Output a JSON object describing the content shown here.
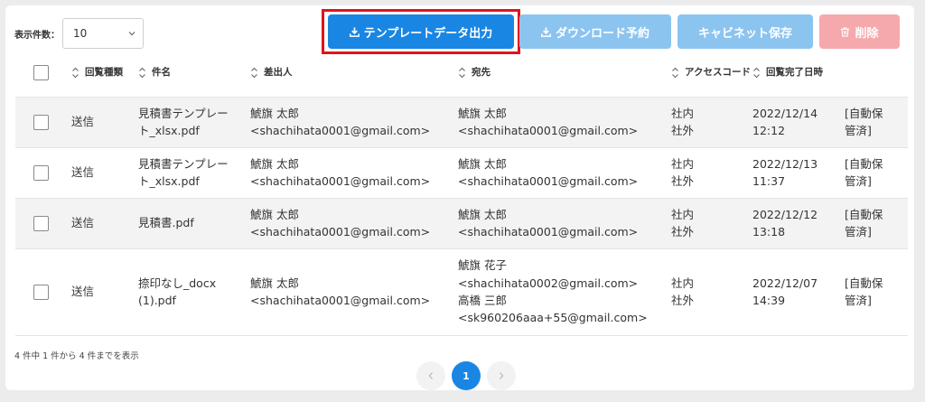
{
  "toolbar": {
    "per_page_label": "表示件数：",
    "per_page_value": "10",
    "template_output_label": "テンプレートデータ出力",
    "download_reserve_label": "ダウンロード予約",
    "cabinet_save_label": "キャビネット保存",
    "delete_label": "削除"
  },
  "table": {
    "headers": {
      "type": [
        "回覧",
        "種類"
      ],
      "subject": "件名",
      "sender": "差出人",
      "recipient": "宛先",
      "access_code": [
        "アクセス",
        "コード"
      ],
      "completed_at": [
        "回覧完了日",
        "時"
      ]
    },
    "rows": [
      {
        "type": "送信",
        "subject": [
          "見積書テンプレー",
          "ト_xlsx.pdf"
        ],
        "sender": [
          "鯱旗 太郎",
          "<shachihata0001@gmail.com>"
        ],
        "recipient": [
          "鯱旗 太郎",
          "<shachihata0001@gmail.com>"
        ],
        "access": [
          "社内",
          "社外"
        ],
        "date": [
          "2022/12/14",
          "12:12"
        ],
        "status": [
          "[自動保",
          "管済]"
        ]
      },
      {
        "type": "送信",
        "subject": [
          "見積書テンプレー",
          "ト_xlsx.pdf"
        ],
        "sender": [
          "鯱旗 太郎",
          "<shachihata0001@gmail.com>"
        ],
        "recipient": [
          "鯱旗 太郎",
          "<shachihata0001@gmail.com>"
        ],
        "access": [
          "社内",
          "社外"
        ],
        "date": [
          "2022/12/13",
          "11:37"
        ],
        "status": [
          "[自動保",
          "管済]"
        ]
      },
      {
        "type": "送信",
        "subject": [
          "見積書.pdf"
        ],
        "sender": [
          "鯱旗 太郎",
          "<shachihata0001@gmail.com>"
        ],
        "recipient": [
          "鯱旗 太郎",
          "<shachihata0001@gmail.com>"
        ],
        "access": [
          "社内",
          "社外"
        ],
        "date": [
          "2022/12/12",
          "13:18"
        ],
        "status": [
          "[自動保",
          "管済]"
        ]
      },
      {
        "type": "送信",
        "subject": [
          "捺印なし_docx",
          "(1).pdf"
        ],
        "sender": [
          "鯱旗 太郎",
          "<shachihata0001@gmail.com>"
        ],
        "recipient": [
          "鯱旗 花子",
          "<shachihata0002@gmail.com>",
          "高橋 三郎",
          "<sk960206aaa+55@gmail.com>"
        ],
        "access": [
          "社内",
          "社外"
        ],
        "date": [
          "2022/12/07",
          "14:39"
        ],
        "status": [
          "[自動保",
          "管済]"
        ]
      }
    ]
  },
  "footer": {
    "summary": "4 件中 1 件から 4 件までを表示"
  },
  "pagination": {
    "current": "1"
  },
  "colors": {
    "primary": "#1a86e3",
    "primary_disabled": "#8cc4f0",
    "danger_disabled": "#f5a9ac",
    "highlight": "#e0141e"
  }
}
